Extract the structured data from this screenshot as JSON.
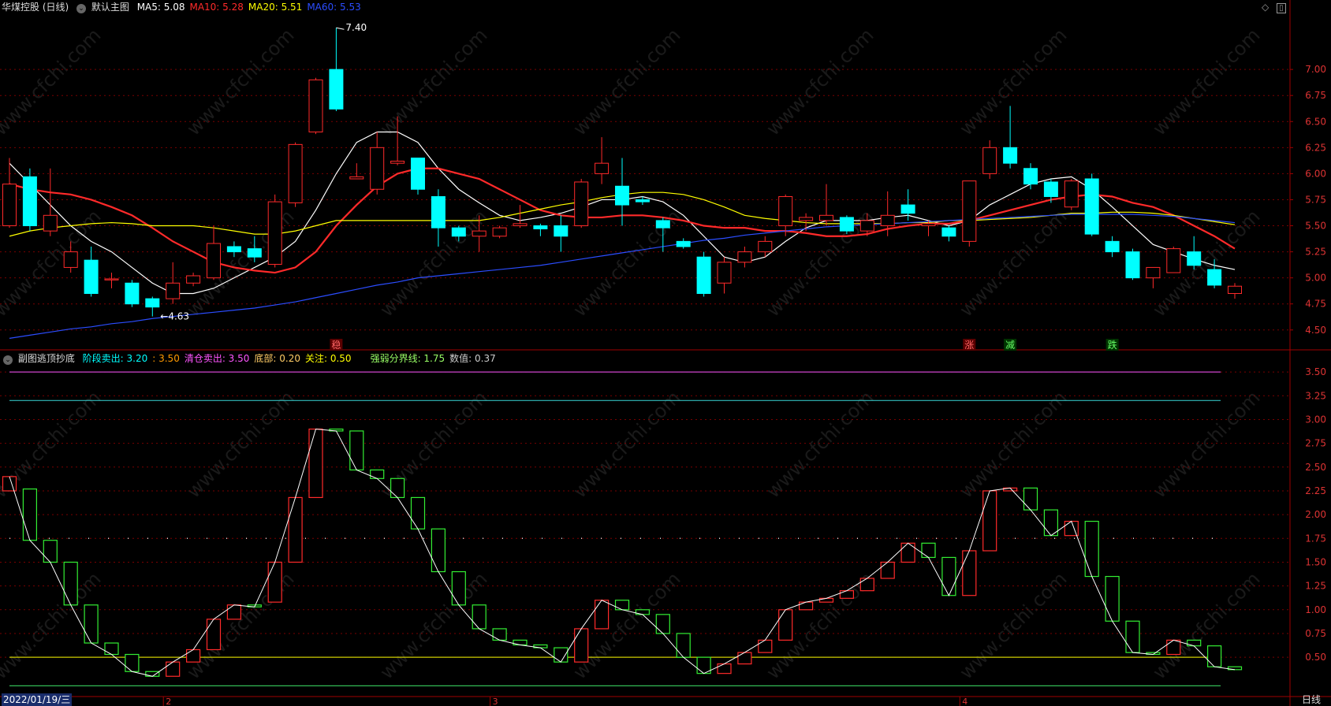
{
  "title": "华煤控股 (日线)",
  "main_label": "默认主图",
  "ma": [
    {
      "label": "MA5:",
      "value": "5.08",
      "color": "#ffffff"
    },
    {
      "label": "MA10:",
      "value": "5.28",
      "color": "#ff2a2a"
    },
    {
      "label": "MA20:",
      "value": "5.51",
      "color": "#ffff00"
    },
    {
      "label": "MA60:",
      "value": "5.53",
      "color": "#2b4dff"
    }
  ],
  "sub_title": "副图逃顶抄底",
  "sub_items": [
    {
      "label": "阶段卖出:",
      "value": "3.20",
      "color": "#00ffff"
    },
    {
      "label": ":",
      "value": "3.50",
      "color": "#ff9900"
    },
    {
      "label": "清仓卖出:",
      "value": "3.50",
      "color": "#ff55ff"
    },
    {
      "label": "底部:",
      "value": "0.20",
      "color": "#ffcc66"
    },
    {
      "label": "关注:",
      "value": "0.50",
      "color": "#ffff00"
    },
    {
      "label": "强弱分界线:",
      "value": "1.75",
      "color": "#99ff66"
    },
    {
      "label": "数值:",
      "value": "0.37",
      "color": "#cccccc"
    }
  ],
  "date_label": "2022/01/19/三",
  "period_label": "日线",
  "watermark": "www.cfchi.com",
  "colors": {
    "up": "#ff2a2a",
    "down": "#00ffff",
    "sub_up": "#ff2a2a",
    "sub_down": "#33ee33",
    "grid": "#7a0000"
  },
  "chart_data": [
    {
      "type": "candlestick",
      "title": "华煤控股 (日线)",
      "ylim": [
        4.4,
        7.5
      ],
      "y_ticks": [
        "7.00",
        "6.75",
        "6.50",
        "6.25",
        "6.00",
        "5.75",
        "5.50",
        "5.25",
        "5.00",
        "4.75",
        "4.50"
      ],
      "annotations": [
        {
          "text": "7.40",
          "value": 7.4
        },
        {
          "text": "4.63",
          "value": 4.63
        }
      ],
      "markers": [
        "稳",
        "涨",
        "减",
        "跌"
      ],
      "x_ticks": [
        "2",
        "3",
        "4"
      ],
      "ohlc": [
        [
          5.5,
          5.9,
          5.48,
          6.15
        ],
        [
          5.97,
          5.5,
          5.45,
          6.05
        ],
        [
          5.45,
          5.6,
          5.4,
          6.05
        ],
        [
          5.1,
          5.25,
          5.05,
          5.35
        ],
        [
          5.17,
          4.85,
          4.82,
          5.3
        ],
        [
          4.98,
          4.99,
          4.9,
          5.05
        ],
        [
          4.95,
          4.75,
          4.72,
          4.98
        ],
        [
          4.8,
          4.72,
          4.63,
          4.82
        ],
        [
          4.8,
          4.95,
          4.75,
          5.15
        ],
        [
          4.95,
          5.02,
          4.92,
          5.05
        ],
        [
          5.0,
          5.33,
          4.98,
          5.5
        ],
        [
          5.3,
          5.25,
          5.2,
          5.35
        ],
        [
          5.28,
          5.2,
          5.15,
          5.4
        ],
        [
          5.13,
          5.73,
          5.1,
          5.8
        ],
        [
          5.72,
          6.28,
          5.68,
          6.3
        ],
        [
          6.4,
          6.9,
          6.38,
          6.92
        ],
        [
          7.0,
          6.62,
          6.6,
          7.4
        ],
        [
          5.95,
          5.97,
          5.95,
          6.1
        ],
        [
          5.85,
          6.25,
          5.8,
          6.4
        ],
        [
          6.1,
          6.12,
          6.08,
          6.55
        ],
        [
          6.15,
          5.85,
          5.8,
          6.15
        ],
        [
          5.78,
          5.48,
          5.3,
          5.85
        ],
        [
          5.48,
          5.4,
          5.35,
          5.5
        ],
        [
          5.4,
          5.45,
          5.25,
          5.6
        ],
        [
          5.4,
          5.48,
          5.38,
          5.5
        ],
        [
          5.5,
          5.52,
          5.48,
          5.7
        ],
        [
          5.5,
          5.47,
          5.4,
          5.52
        ],
        [
          5.5,
          5.4,
          5.25,
          5.6
        ],
        [
          5.5,
          5.92,
          5.48,
          5.95
        ],
        [
          6.0,
          6.1,
          5.9,
          6.35
        ],
        [
          5.88,
          5.7,
          5.5,
          6.15
        ],
        [
          5.75,
          5.73,
          5.7,
          5.78
        ],
        [
          5.55,
          5.48,
          5.25,
          5.58
        ],
        [
          5.35,
          5.3,
          5.28,
          5.38
        ],
        [
          5.2,
          4.85,
          4.82,
          5.25
        ],
        [
          4.95,
          5.15,
          4.85,
          5.2
        ],
        [
          5.15,
          5.25,
          5.1,
          5.3
        ],
        [
          5.25,
          5.35,
          5.2,
          5.4
        ],
        [
          5.5,
          5.78,
          5.4,
          5.8
        ],
        [
          5.55,
          5.58,
          5.45,
          5.62
        ],
        [
          5.55,
          5.6,
          5.5,
          5.9
        ],
        [
          5.58,
          5.45,
          5.42,
          5.6
        ],
        [
          5.45,
          5.55,
          5.4,
          5.62
        ],
        [
          5.5,
          5.6,
          5.4,
          5.83
        ],
        [
          5.7,
          5.62,
          5.55,
          5.85
        ],
        [
          5.5,
          5.52,
          5.4,
          5.55
        ],
        [
          5.48,
          5.4,
          5.35,
          5.5
        ],
        [
          5.35,
          5.93,
          5.3,
          5.93
        ],
        [
          6.0,
          6.25,
          5.95,
          6.32
        ],
        [
          6.25,
          6.1,
          6.05,
          6.65
        ],
        [
          6.05,
          5.9,
          5.85,
          6.1
        ],
        [
          5.92,
          5.78,
          5.72,
          5.95
        ],
        [
          5.68,
          5.93,
          5.65,
          5.95
        ],
        [
          5.95,
          5.42,
          5.4,
          6.0
        ],
        [
          5.35,
          5.25,
          5.2,
          5.4
        ],
        [
          5.25,
          5.0,
          4.98,
          5.28
        ],
        [
          5.0,
          5.1,
          4.9,
          5.1
        ],
        [
          5.05,
          5.28,
          5.05,
          5.3
        ],
        [
          5.25,
          5.12,
          5.08,
          5.4
        ],
        [
          5.08,
          4.93,
          4.9,
          5.18
        ],
        [
          4.85,
          4.92,
          4.8,
          4.95
        ]
      ],
      "series": [
        {
          "name": "MA5",
          "values": [
            6.1,
            5.9,
            5.7,
            5.5,
            5.35,
            5.25,
            5.1,
            4.95,
            4.85,
            4.85,
            4.9,
            5.0,
            5.1,
            5.2,
            5.35,
            5.65,
            6.0,
            6.3,
            6.4,
            6.4,
            6.3,
            6.05,
            5.85,
            5.72,
            5.6,
            5.55,
            5.58,
            5.62,
            5.68,
            5.75,
            5.75,
            5.78,
            5.73,
            5.6,
            5.4,
            5.2,
            5.15,
            5.2,
            5.35,
            5.48,
            5.55,
            5.55,
            5.55,
            5.58,
            5.6,
            5.55,
            5.5,
            5.55,
            5.7,
            5.8,
            5.9,
            5.95,
            5.97,
            5.85,
            5.68,
            5.5,
            5.32,
            5.25,
            5.18,
            5.12,
            5.08
          ]
        },
        {
          "name": "MA10",
          "values": [
            5.9,
            5.85,
            5.82,
            5.8,
            5.75,
            5.68,
            5.6,
            5.48,
            5.35,
            5.25,
            5.15,
            5.1,
            5.07,
            5.05,
            5.1,
            5.25,
            5.5,
            5.7,
            5.88,
            6.0,
            6.05,
            6.05,
            6.0,
            5.95,
            5.85,
            5.75,
            5.65,
            5.6,
            5.58,
            5.58,
            5.6,
            5.6,
            5.58,
            5.55,
            5.5,
            5.48,
            5.48,
            5.45,
            5.45,
            5.43,
            5.4,
            5.4,
            5.42,
            5.47,
            5.5,
            5.52,
            5.52,
            5.55,
            5.6,
            5.65,
            5.7,
            5.75,
            5.78,
            5.8,
            5.78,
            5.72,
            5.68,
            5.6,
            5.5,
            5.4,
            5.28
          ]
        },
        {
          "name": "MA20",
          "values": [
            5.4,
            5.45,
            5.48,
            5.5,
            5.52,
            5.53,
            5.52,
            5.5,
            5.5,
            5.5,
            5.48,
            5.45,
            5.42,
            5.42,
            5.45,
            5.5,
            5.55,
            5.55,
            5.55,
            5.55,
            5.55,
            5.55,
            5.55,
            5.55,
            5.58,
            5.62,
            5.66,
            5.7,
            5.73,
            5.77,
            5.8,
            5.82,
            5.82,
            5.8,
            5.75,
            5.68,
            5.6,
            5.57,
            5.55,
            5.53,
            5.52,
            5.52,
            5.52,
            5.52,
            5.53,
            5.53,
            5.55,
            5.55,
            5.56,
            5.57,
            5.58,
            5.6,
            5.62,
            5.62,
            5.63,
            5.63,
            5.62,
            5.6,
            5.57,
            5.54,
            5.51
          ]
        },
        {
          "name": "MA60",
          "values": [
            4.42,
            4.45,
            4.48,
            4.51,
            4.53,
            4.56,
            4.58,
            4.61,
            4.63,
            4.65,
            4.67,
            4.69,
            4.71,
            4.74,
            4.77,
            4.81,
            4.85,
            4.89,
            4.93,
            4.96,
            5.0,
            5.02,
            5.04,
            5.06,
            5.08,
            5.1,
            5.12,
            5.15,
            5.18,
            5.21,
            5.24,
            5.27,
            5.3,
            5.33,
            5.36,
            5.38,
            5.41,
            5.43,
            5.45,
            5.47,
            5.49,
            5.5,
            5.51,
            5.52,
            5.53,
            5.54,
            5.55,
            5.56,
            5.57,
            5.58,
            5.59,
            5.6,
            5.61,
            5.61,
            5.61,
            5.61,
            5.6,
            5.59,
            5.57,
            5.55,
            5.53
          ]
        }
      ]
    },
    {
      "type": "bar",
      "title": "副图逃顶抄底",
      "ylim": [
        0.12,
        3.7
      ],
      "y_ticks": [
        "3.50",
        "3.25",
        "3.00",
        "2.75",
        "2.50",
        "2.25",
        "2.00",
        "1.75",
        "1.50",
        "1.25",
        "1.00",
        "0.75",
        "0.50"
      ],
      "levels": [
        3.5,
        3.2,
        1.75,
        0.5,
        0.2
      ],
      "bars": [
        [
          2.25,
          2.4
        ],
        [
          2.27,
          1.73
        ],
        [
          1.73,
          1.5
        ],
        [
          1.5,
          1.05
        ],
        [
          1.05,
          0.65
        ],
        [
          0.65,
          0.53
        ],
        [
          0.53,
          0.35
        ],
        [
          0.35,
          0.3
        ],
        [
          0.3,
          0.45
        ],
        [
          0.45,
          0.58
        ],
        [
          0.58,
          0.9
        ],
        [
          0.9,
          1.05
        ],
        [
          1.05,
          1.03
        ],
        [
          1.08,
          1.5
        ],
        [
          1.5,
          2.18
        ],
        [
          2.18,
          2.9
        ],
        [
          2.9,
          2.88
        ],
        [
          2.88,
          2.47
        ],
        [
          2.47,
          2.38
        ],
        [
          2.38,
          2.18
        ],
        [
          2.18,
          1.85
        ],
        [
          1.85,
          1.4
        ],
        [
          1.4,
          1.05
        ],
        [
          1.05,
          0.8
        ],
        [
          0.8,
          0.68
        ],
        [
          0.68,
          0.63
        ],
        [
          0.63,
          0.6
        ],
        [
          0.6,
          0.45
        ],
        [
          0.45,
          0.8
        ],
        [
          0.8,
          1.1
        ],
        [
          1.1,
          1.0
        ],
        [
          1.0,
          0.95
        ],
        [
          0.95,
          0.75
        ],
        [
          0.75,
          0.5
        ],
        [
          0.5,
          0.33
        ],
        [
          0.33,
          0.43
        ],
        [
          0.43,
          0.55
        ],
        [
          0.55,
          0.68
        ],
        [
          0.68,
          1.0
        ],
        [
          1.0,
          1.08
        ],
        [
          1.08,
          1.12
        ],
        [
          1.12,
          1.2
        ],
        [
          1.2,
          1.33
        ],
        [
          1.33,
          1.5
        ],
        [
          1.5,
          1.7
        ],
        [
          1.7,
          1.55
        ],
        [
          1.55,
          1.15
        ],
        [
          1.15,
          1.62
        ],
        [
          1.62,
          2.25
        ],
        [
          2.25,
          2.28
        ],
        [
          2.28,
          2.05
        ],
        [
          2.05,
          1.78
        ],
        [
          1.78,
          1.93
        ],
        [
          1.93,
          1.35
        ],
        [
          1.35,
          0.88
        ],
        [
          0.88,
          0.55
        ],
        [
          0.55,
          0.53
        ],
        [
          0.53,
          0.68
        ],
        [
          0.68,
          0.62
        ],
        [
          0.62,
          0.4
        ],
        [
          0.4,
          0.37
        ]
      ],
      "series": [
        {
          "name": "数值",
          "values": [
            2.4,
            1.73,
            1.5,
            1.05,
            0.65,
            0.53,
            0.35,
            0.3,
            0.45,
            0.58,
            0.9,
            1.05,
            1.03,
            1.5,
            2.18,
            2.9,
            2.88,
            2.47,
            2.38,
            2.18,
            1.85,
            1.4,
            1.05,
            0.8,
            0.68,
            0.63,
            0.6,
            0.45,
            0.8,
            1.1,
            1.0,
            0.95,
            0.75,
            0.5,
            0.33,
            0.43,
            0.55,
            0.68,
            1.0,
            1.08,
            1.12,
            1.2,
            1.33,
            1.5,
            1.7,
            1.55,
            1.15,
            1.62,
            2.25,
            2.28,
            2.05,
            1.78,
            1.93,
            1.35,
            0.88,
            0.55,
            0.53,
            0.68,
            0.62,
            0.4,
            0.37
          ]
        }
      ]
    }
  ]
}
